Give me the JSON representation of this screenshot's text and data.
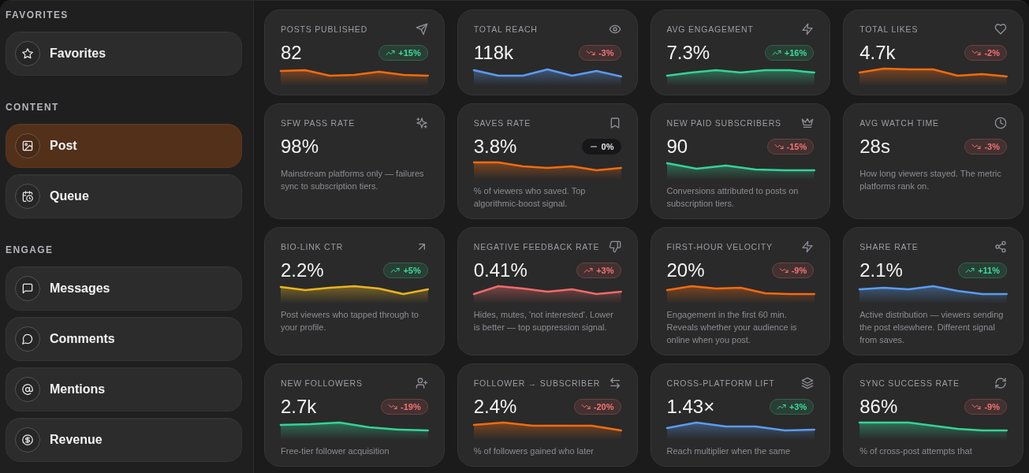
{
  "sidebar": {
    "sections": [
      {
        "title": "FAVORITES",
        "items": [
          {
            "label": "Favorites",
            "selected": false
          }
        ]
      },
      {
        "title": "CONTENT",
        "items": [
          {
            "label": "Post",
            "selected": true
          },
          {
            "label": "Queue",
            "selected": false
          }
        ]
      },
      {
        "title": "ENGAGE",
        "items": [
          {
            "label": "Messages",
            "selected": false
          },
          {
            "label": "Comments",
            "selected": false
          },
          {
            "label": "Mentions",
            "selected": false
          },
          {
            "label": "Revenue",
            "selected": false
          }
        ]
      }
    ]
  },
  "cards": [
    {
      "kind": "sparkline",
      "label": "POSTS PUBLISHED",
      "value": "82",
      "change": {
        "text": "+15%",
        "kind": "rise",
        "color": "#3ddc9a"
      },
      "color": "#f26b10"
    },
    {
      "kind": "sparkline",
      "label": "TOTAL REACH",
      "value": "118k",
      "change": {
        "text": "-3%",
        "kind": "fall",
        "color": "#f57373"
      },
      "color": "#5b9cf0"
    },
    {
      "kind": "sparkline",
      "label": "AVG ENGAGEMENT",
      "value": "7.3%",
      "change": {
        "text": "+16%",
        "kind": "rise",
        "color": "#3ddc9a"
      },
      "color": "#34d399"
    },
    {
      "kind": "sparkline",
      "label": "TOTAL LIKES",
      "value": "4.7k",
      "change": {
        "text": "-2%",
        "kind": "fall",
        "color": "#f57373"
      },
      "color": "#f26b10"
    },
    {
      "kind": "plain",
      "label": "SFW PASS RATE",
      "value": "98%",
      "description": "Mainstream platforms only — failures sync to subscription tiers."
    },
    {
      "kind": "sparkline",
      "label": "SAVES RATE",
      "value": "3.8%",
      "change": {
        "text": "0%",
        "kind": "flat",
        "color": "#e6e6ea"
      },
      "color": "#f26b10",
      "description": "% of viewers who saved. Top algorithmic-boost signal."
    },
    {
      "kind": "sparkline",
      "label": "NEW PAID SUBSCRIBERS",
      "value": "90",
      "change": {
        "text": "-15%",
        "kind": "fall",
        "color": "#f57373"
      },
      "color": "#34d399",
      "description": "Conversions attributed to posts on subscription tiers."
    },
    {
      "kind": "plain",
      "label": "AVG WATCH TIME",
      "value": "28s",
      "change": {
        "text": "-3%",
        "kind": "fall",
        "color": "#f57373"
      },
      "description": "How long viewers stayed. The metric platforms rank on."
    },
    {
      "kind": "sparkline",
      "label": "BIO-LINK CTR",
      "value": "2.2%",
      "change": {
        "text": "+5%",
        "kind": "rise",
        "color": "#3ddc9a"
      },
      "color": "#eab320",
      "description": "Post viewers who tapped through to your profile."
    },
    {
      "kind": "sparkline",
      "label": "NEGATIVE FEEDBACK RATE",
      "value": "0.41%",
      "change": {
        "text": "+3%",
        "kind": "rise",
        "color": "#f57373"
      },
      "color": "#f06b6b",
      "description": "Hides, mutes, 'not interested'. Lower is better — top suppression signal."
    },
    {
      "kind": "sparkline",
      "label": "FIRST-HOUR VELOCITY",
      "value": "20%",
      "change": {
        "text": "-9%",
        "kind": "fall",
        "color": "#f57373"
      },
      "color": "#f26b10",
      "description": "Engagement in the first 60 min. Reveals whether your audience is online when you post."
    },
    {
      "kind": "sparkline",
      "label": "SHARE RATE",
      "value": "2.1%",
      "change": {
        "text": "+11%",
        "kind": "rise",
        "color": "#3ddc9a"
      },
      "color": "#5b9cf0",
      "description": "Active distribution — viewers sending the post elsewhere. Different signal from saves."
    },
    {
      "kind": "sparkline",
      "label": "NEW FOLLOWERS",
      "value": "2.7k",
      "change": {
        "text": "-19%",
        "kind": "fall",
        "color": "#f57373"
      },
      "color": "#34d399",
      "description": "Free-tier follower acquisition"
    },
    {
      "kind": "sparkline",
      "label": "FOLLOWER → SUBSCRIBER",
      "value": "2.4%",
      "change": {
        "text": "-20%",
        "kind": "fall",
        "color": "#f57373"
      },
      "color": "#f26b10",
      "description": "% of followers gained who later"
    },
    {
      "kind": "sparkline",
      "label": "CROSS-PLATFORM LIFT",
      "value": "1.43×",
      "change": {
        "text": "+3%",
        "kind": "rise",
        "color": "#3ddc9a"
      },
      "color": "#5b9cf0",
      "description": "Reach multiplier when the same"
    },
    {
      "kind": "sparkline",
      "label": "SYNC SUCCESS RATE",
      "value": "86%",
      "change": {
        "text": "-9%",
        "kind": "fall",
        "color": "#f57373"
      },
      "color": "#34d399",
      "description": "% of cross-post attempts that"
    }
  ]
}
